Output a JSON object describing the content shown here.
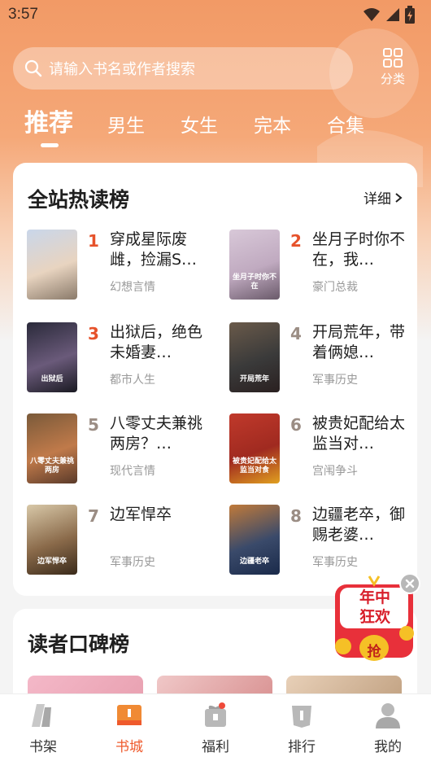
{
  "status_bar": {
    "time": "3:57"
  },
  "search": {
    "placeholder": "请输入书名或作者搜索"
  },
  "category": {
    "label": "分类"
  },
  "tabs": [
    {
      "label": "推荐",
      "active": true
    },
    {
      "label": "男生"
    },
    {
      "label": "女生"
    },
    {
      "label": "完本"
    },
    {
      "label": "合集"
    }
  ],
  "hot_list": {
    "title": "全站热读榜",
    "detail_label": "详细",
    "books": [
      {
        "rank": "1",
        "title": "穿成星际废雌，捡漏S…",
        "tag": "幻想言情",
        "cover_colors": [
          "#c9d6ea",
          "#e8d4c0",
          "#8a7a6a"
        ],
        "cover_text": ""
      },
      {
        "rank": "2",
        "title": "坐月子时你不在，我…",
        "tag": "豪门总裁",
        "cover_colors": [
          "#d8c8d8",
          "#c0aac0",
          "#6a5a6a"
        ],
        "cover_text": "坐月子时你不在"
      },
      {
        "rank": "3",
        "title": "出狱后，绝色未婚妻…",
        "tag": "都市人生",
        "cover_colors": [
          "#2a2a3a",
          "#6a5a7a",
          "#1a1a22"
        ],
        "cover_text": "出狱后"
      },
      {
        "rank": "4",
        "title": "开局荒年，带着俩媳…",
        "tag": "军事历史",
        "cover_colors": [
          "#6a5a4a",
          "#3a3a3a",
          "#2a2020"
        ],
        "cover_text": "开局荒年"
      },
      {
        "rank": "5",
        "title": "八零丈夫兼祧两房？…",
        "tag": "现代言情",
        "cover_colors": [
          "#7a5a3a",
          "#c07a4a",
          "#5a3a2a"
        ],
        "cover_text": "八零丈夫兼祧两房"
      },
      {
        "rank": "6",
        "title": "被贵妃配给太监当对…",
        "tag": "宫闱争斗",
        "cover_colors": [
          "#c0392b",
          "#a02a20",
          "#e0a020"
        ],
        "cover_text": "被贵妃配给太监当对食"
      },
      {
        "rank": "7",
        "title": "边军悍卒",
        "tag": "军事历史",
        "cover_colors": [
          "#d8c8a8",
          "#8a6a4a",
          "#3a2a1a"
        ],
        "cover_text": "边军悍卒"
      },
      {
        "rank": "8",
        "title": "边疆老卒，御赐老婆…",
        "tag": "军事历史",
        "cover_colors": [
          "#c07a3a",
          "#3a4a6a",
          "#1a2a4a"
        ],
        "cover_text": "边疆老卒"
      }
    ]
  },
  "reader_list": {
    "title": "读者口碑榜"
  },
  "promo": {
    "line1": "年中",
    "line2": "狂欢",
    "coin": "抢"
  },
  "nav": [
    {
      "label": "书架",
      "icon": "bookshelf-icon"
    },
    {
      "label": "书城",
      "icon": "bookstore-icon",
      "active": true
    },
    {
      "label": "福利",
      "icon": "gift-icon",
      "dot": true
    },
    {
      "label": "排行",
      "icon": "ranking-icon"
    },
    {
      "label": "我的",
      "icon": "profile-icon"
    }
  ],
  "colors": {
    "accent": "#ef5a2c",
    "header": "#f29a66",
    "rank_hot": "#e6522b",
    "rank_normal": "#9b8d84"
  }
}
